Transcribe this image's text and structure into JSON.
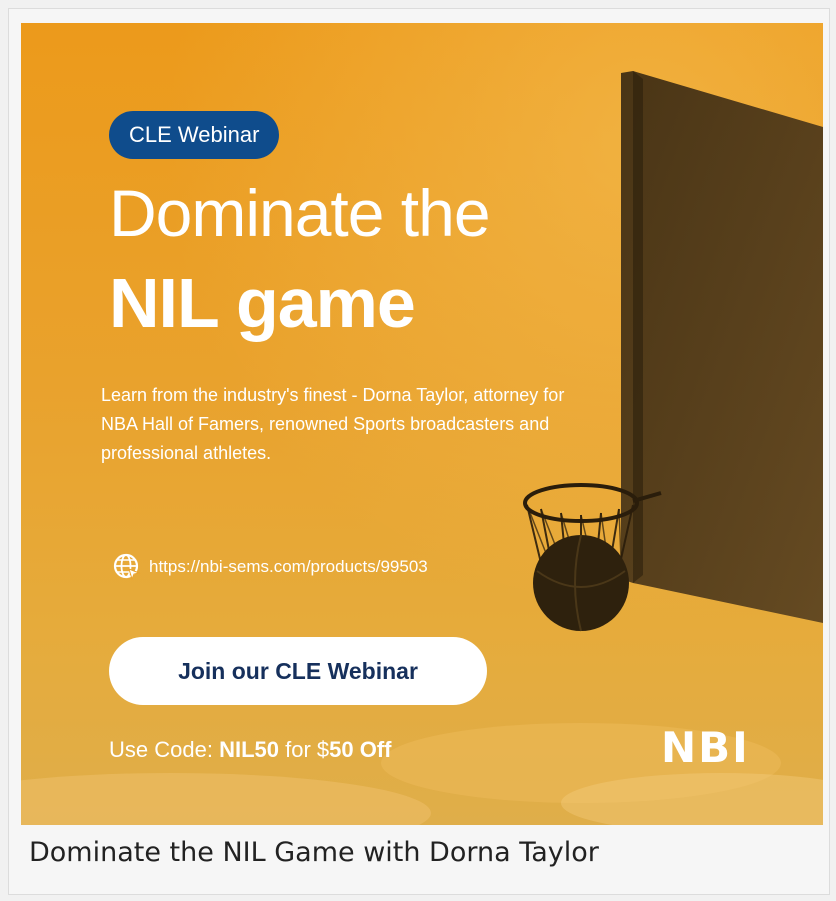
{
  "banner": {
    "badge": "CLE Webinar",
    "headline_line1": "Dominate the",
    "headline_line2": "NIL game",
    "description": "Learn from the industry's finest - Dorna Taylor, attorney for NBA Hall of Famers, renowned Sports broadcasters and professional athletes.",
    "url": "https://nbi-sems.com/products/99503",
    "cta_label": "Join our CLE Webinar",
    "promo_prefix": "Use Code: ",
    "promo_code": "NIL50",
    "promo_middle": " for $",
    "promo_amount": "50 Off",
    "logo": "NBI",
    "colors": {
      "background": "#e9a22d",
      "badge": "#0f4c8c",
      "cta_text": "#16305c"
    }
  },
  "caption": "Dominate the NIL Game with Dorna Taylor",
  "icons": {
    "url_icon": "globe-cursor-icon"
  }
}
